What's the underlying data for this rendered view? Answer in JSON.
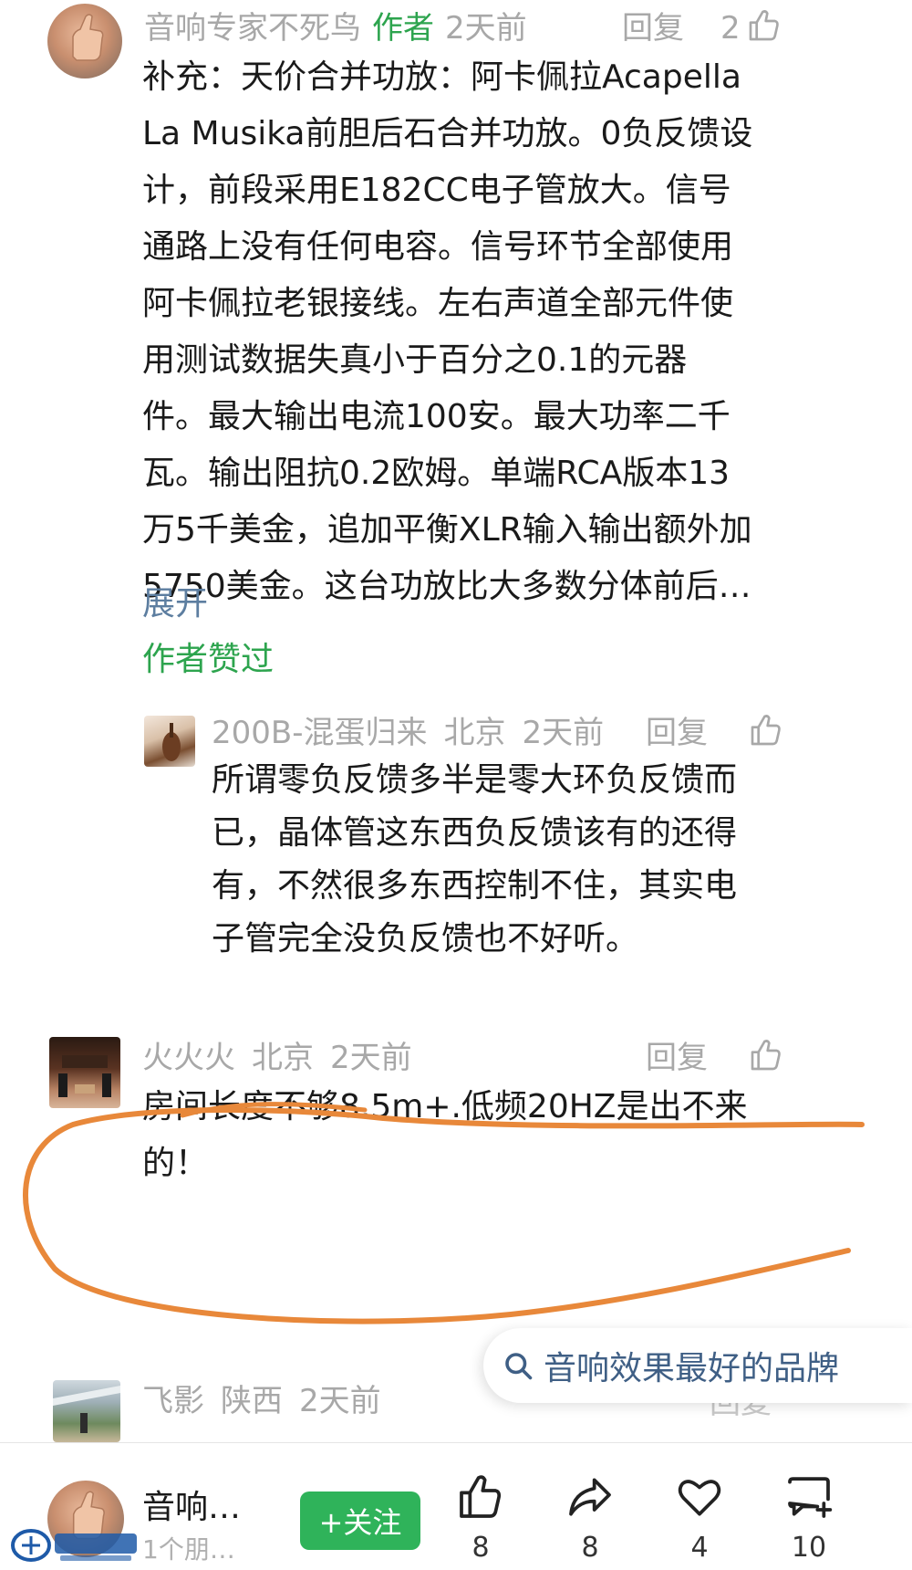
{
  "comment1": {
    "username": "音响专家不死鸟",
    "author_tag": "作者",
    "time": "2天前",
    "reply_label": "回复",
    "like_count": "2",
    "lines": [
      "补充：天价合并功放：阿卡佩拉Acapella",
      "La Musika前胆后石合并功放。0负反馈设",
      "计，前段采用E182CC电子管放大。信号",
      "通路上没有任何电容。信号环节全部使用",
      "阿卡佩拉老银接线。左右声道全部元件使",
      "用测试数据失真小于百分之0.1的元器",
      "件。最大输出电流100安。最大功率二千",
      "瓦。输出阻抗0.2欧姆。单端RCA版本13",
      "万5千美金，追加平衡XLR输入输出额外加",
      "5750美金。这台功放比大多数分体前后…"
    ],
    "expand_label": "展开",
    "author_liked_label": "作者赞过"
  },
  "reply1": {
    "username": "200B-混蛋归来",
    "location": "北京",
    "time": "2天前",
    "reply_label": "回复",
    "lines": [
      "所谓零负反馈多半是零大环负反馈而",
      "已，晶体管这东西负反馈该有的还得",
      "有，不然很多东西控制不住，其实电",
      "子管完全没负反馈也不好听。"
    ]
  },
  "comment2": {
    "username": "火火火",
    "location": "北京",
    "time": "2天前",
    "reply_label": "回复",
    "lines": [
      "房间长度不够8.5m+.低频20HZ是出不来",
      "的！"
    ]
  },
  "comment3": {
    "username": "飞影",
    "location": "陕西",
    "time": "2天前",
    "reply_label": "回复"
  },
  "search_chip": {
    "text": "音响效果最好的品牌"
  },
  "bottom_bar": {
    "author_name": "音响…",
    "author_sub": "1个朋…",
    "follow_label": "+关注",
    "like_count": "8",
    "share_count": "8",
    "favorite_count": "4",
    "comment_count": "10"
  },
  "colors": {
    "green": "#2da44e",
    "link_blue": "#5d7ea0",
    "meta_gray": "#a8a8a8",
    "highlight_orange": "#e8883a"
  },
  "icons": [
    "thumbs-up-icon",
    "search-icon",
    "share-icon",
    "heart-icon",
    "comment-plus-icon"
  ]
}
